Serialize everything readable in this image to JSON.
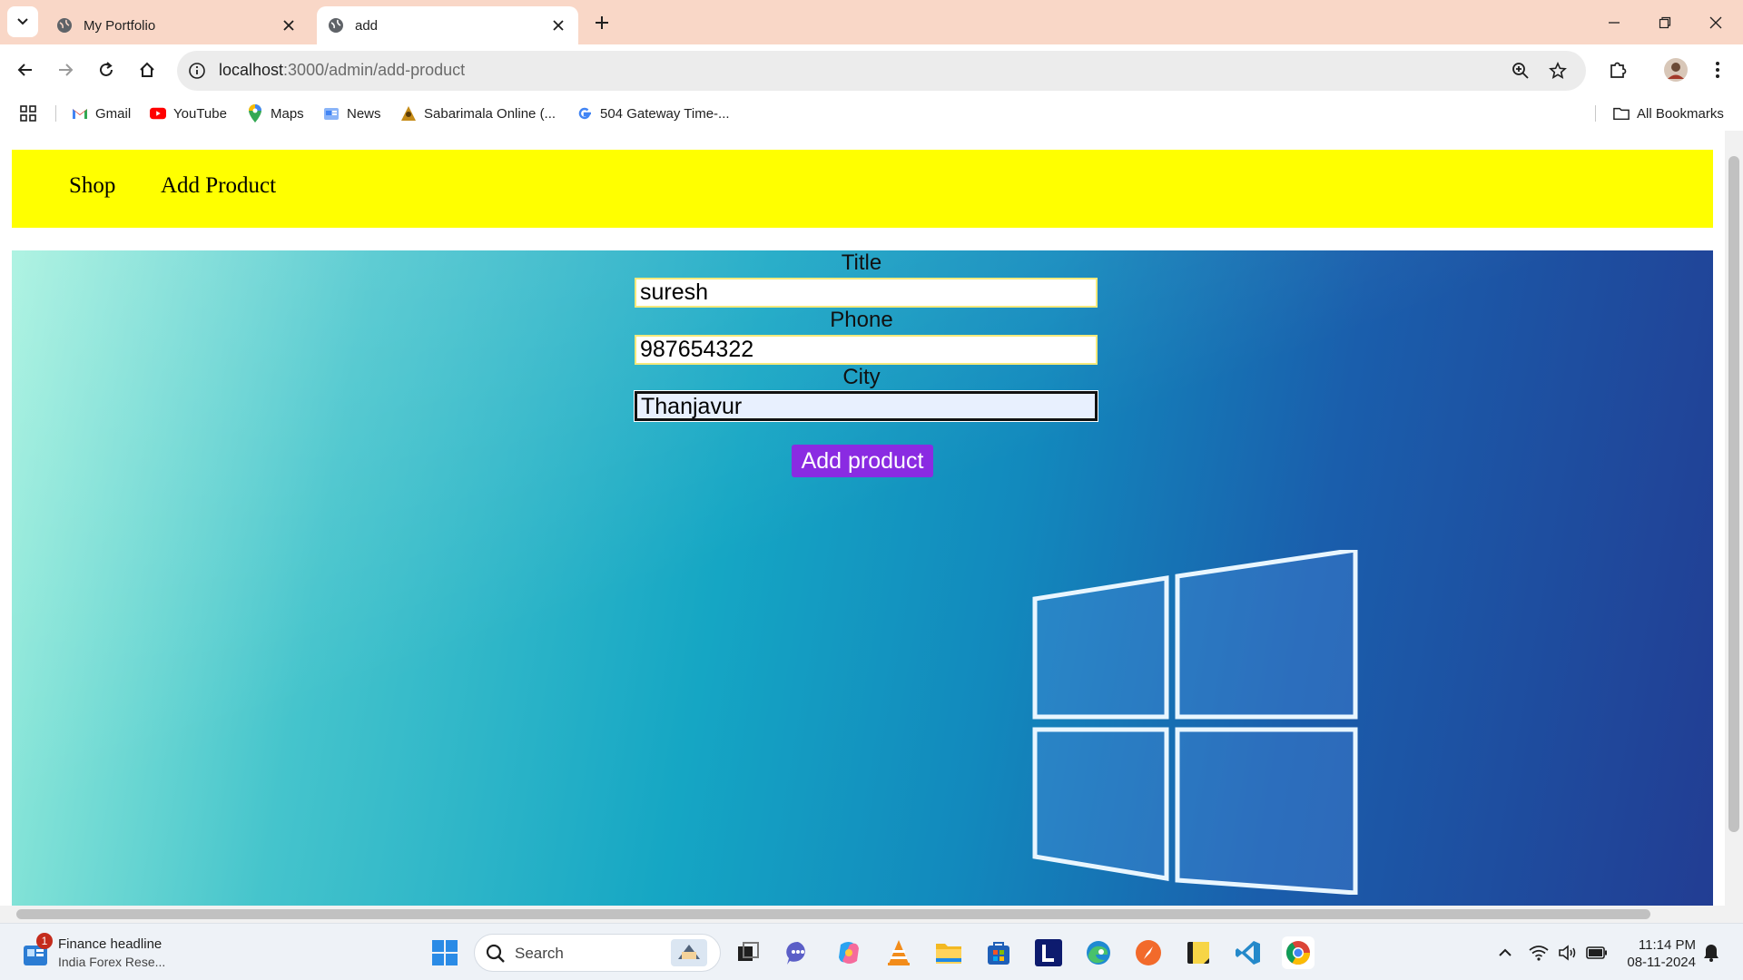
{
  "browser": {
    "tabs": [
      {
        "title": "My Portfolio",
        "active": false
      },
      {
        "title": "add",
        "active": true
      }
    ],
    "url": {
      "host": "localhost",
      "path": ":3000/admin/add-product"
    },
    "bookmarks": [
      {
        "label": "Gmail",
        "icon": "gmail-icon"
      },
      {
        "label": "YouTube",
        "icon": "youtube-icon"
      },
      {
        "label": "Maps",
        "icon": "maps-icon"
      },
      {
        "label": "News",
        "icon": "news-icon"
      },
      {
        "label": "Sabarimala Online (...",
        "icon": "sabarimala-icon"
      },
      {
        "label": "504 Gateway Time-...",
        "icon": "google-icon"
      }
    ],
    "all_bookmarks": "All Bookmarks"
  },
  "site": {
    "nav": [
      {
        "label": "Shop"
      },
      {
        "label": "Add Product"
      }
    ],
    "form": {
      "title_label": "Title",
      "title_value": "suresh",
      "phone_label": "Phone",
      "phone_value": "987654322",
      "city_label": "City",
      "city_value": "Thanjavur",
      "submit_label": "Add product"
    },
    "colors": {
      "nav_bg": "#ffff00",
      "submit_bg": "#8a2be2"
    }
  },
  "taskbar": {
    "news_title": "Finance headline",
    "news_sub": "India Forex Rese...",
    "news_badge": "1",
    "search_label": "Search",
    "time": "11:14 PM",
    "date": "08-11-2024"
  }
}
